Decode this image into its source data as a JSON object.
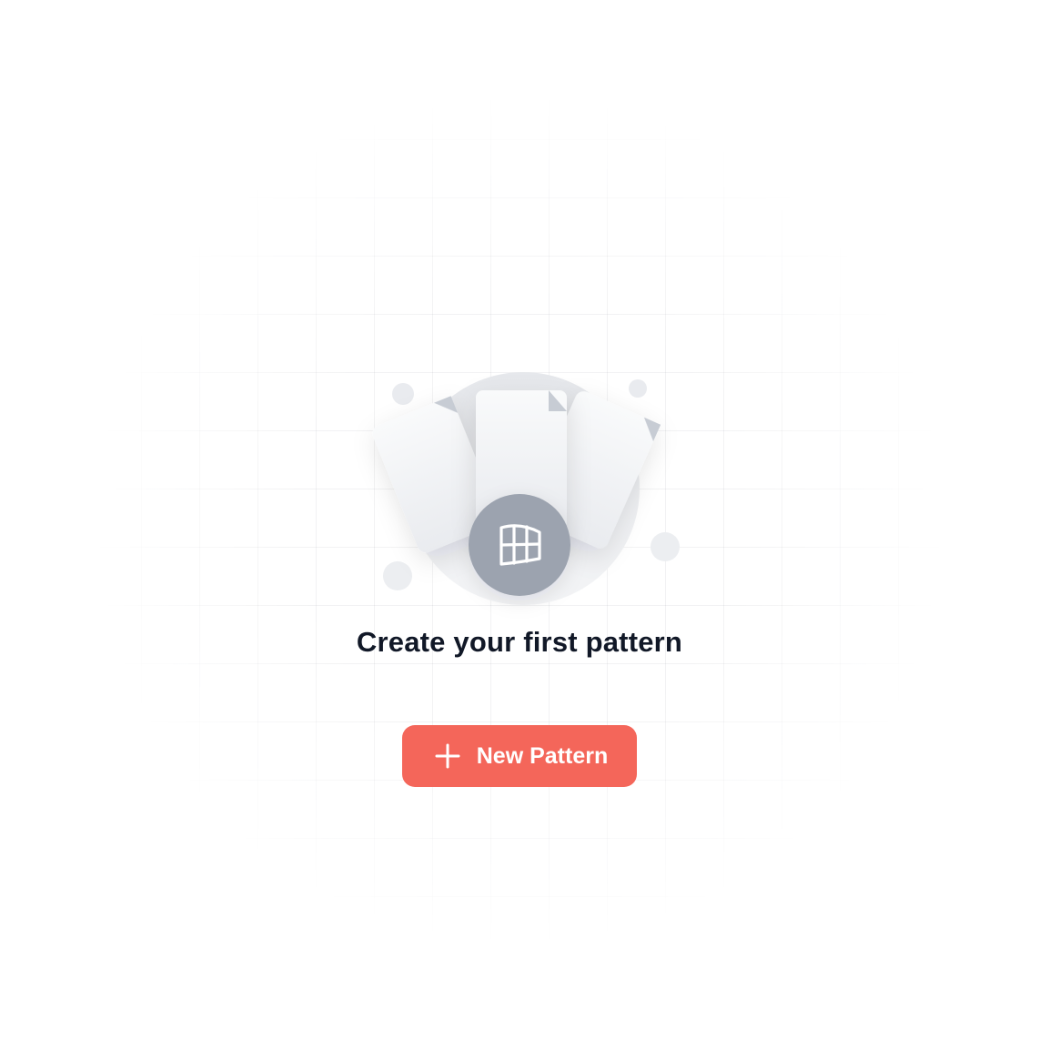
{
  "empty_state": {
    "title": "Create your first pattern",
    "button_label": "New Pattern",
    "button_icon": "plus-icon",
    "illustration_icon": "pattern-grid-icon"
  },
  "colors": {
    "accent": "#f4665a",
    "title_text": "#111827",
    "badge": "#9ca3af",
    "circle_bg": "#e5e7eb"
  }
}
